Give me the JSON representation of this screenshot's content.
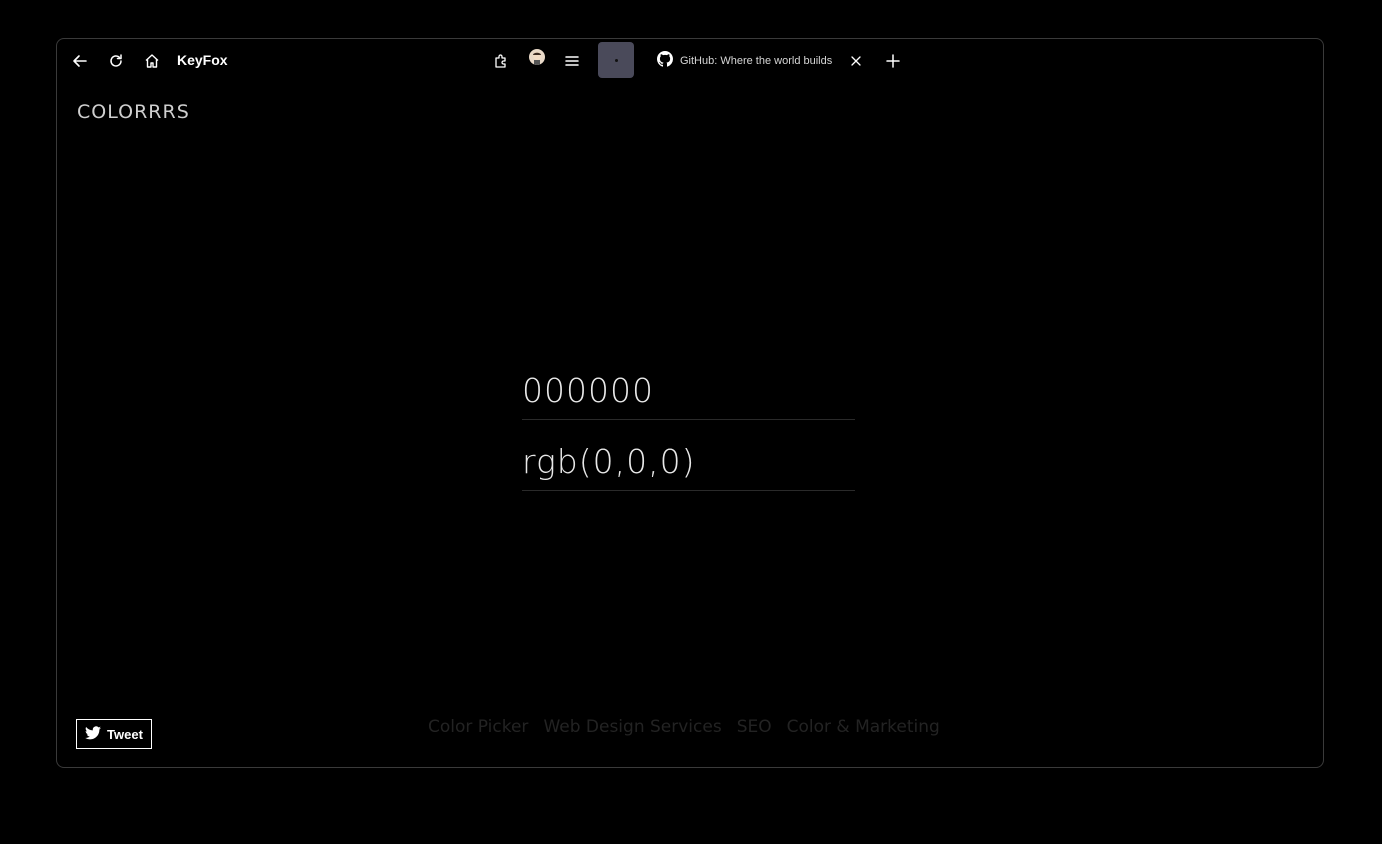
{
  "browser": {
    "app_title": "KeyFox",
    "tab": {
      "label": "GitHub: Where the world builds",
      "icon": "github-icon"
    },
    "icons": [
      "back-icon",
      "reload-icon",
      "home-icon",
      "extensions-icon",
      "avatar",
      "menu-icon",
      "close-icon",
      "new-tab-icon"
    ]
  },
  "page": {
    "brand": "COLORRRS",
    "hex_value": "000000",
    "rgb_value": "rgb(0,0,0)",
    "tweet_label": "Tweet",
    "footer_links": [
      "Color Picker",
      "Web Design Services",
      "SEO",
      "Color & Marketing"
    ]
  },
  "colors": {
    "background": "#000000",
    "text": "#e8e8e8",
    "footer_link": "#232323"
  }
}
